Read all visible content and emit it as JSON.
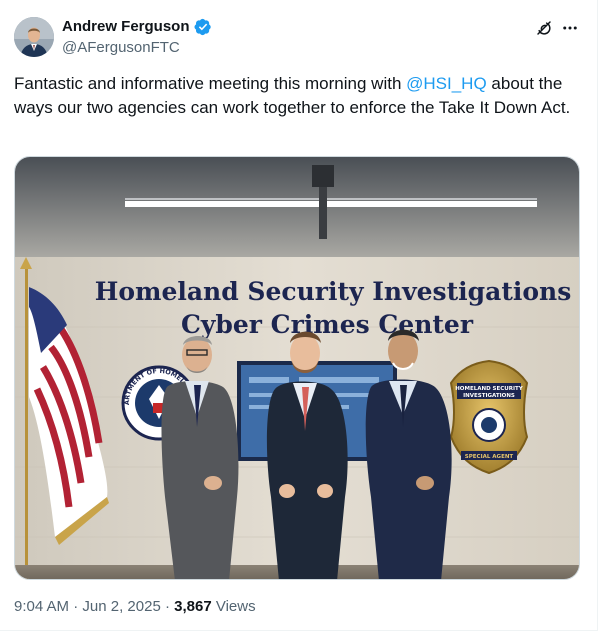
{
  "author": {
    "display_name": "Andrew Ferguson",
    "handle": "@AFergusonFTC",
    "verified_color": "#1d9bf0"
  },
  "icons": {
    "grok": "grok-icon",
    "more": "more-icon"
  },
  "tweet": {
    "text_before": "Fantastic and informative meeting this morning with ",
    "mention": "@HSI_HQ",
    "text_after": " about the ways our two agencies can work together to enforce the Take It Down Act."
  },
  "media": {
    "wall_sign_line1": "Homeland Security Investigations",
    "wall_sign_line2": "Cyber Crimes Center",
    "seal_text": "U.S. DEPARTMENT OF HOMELAND SECURITY",
    "badge_line1": "HOMELAND SECURITY",
    "badge_line2": "INVESTIGATIONS",
    "badge_line3": "SPECIAL AGENT"
  },
  "meta": {
    "time": "9:04 AM",
    "date": "Jun 2, 2025",
    "separator": "·",
    "views_count": "3,867",
    "views_label": "Views"
  },
  "colors": {
    "link": "#1d9bf0",
    "secondary_text": "#536471",
    "primary_text": "#0f1419",
    "wall_text": "#1c2550"
  }
}
